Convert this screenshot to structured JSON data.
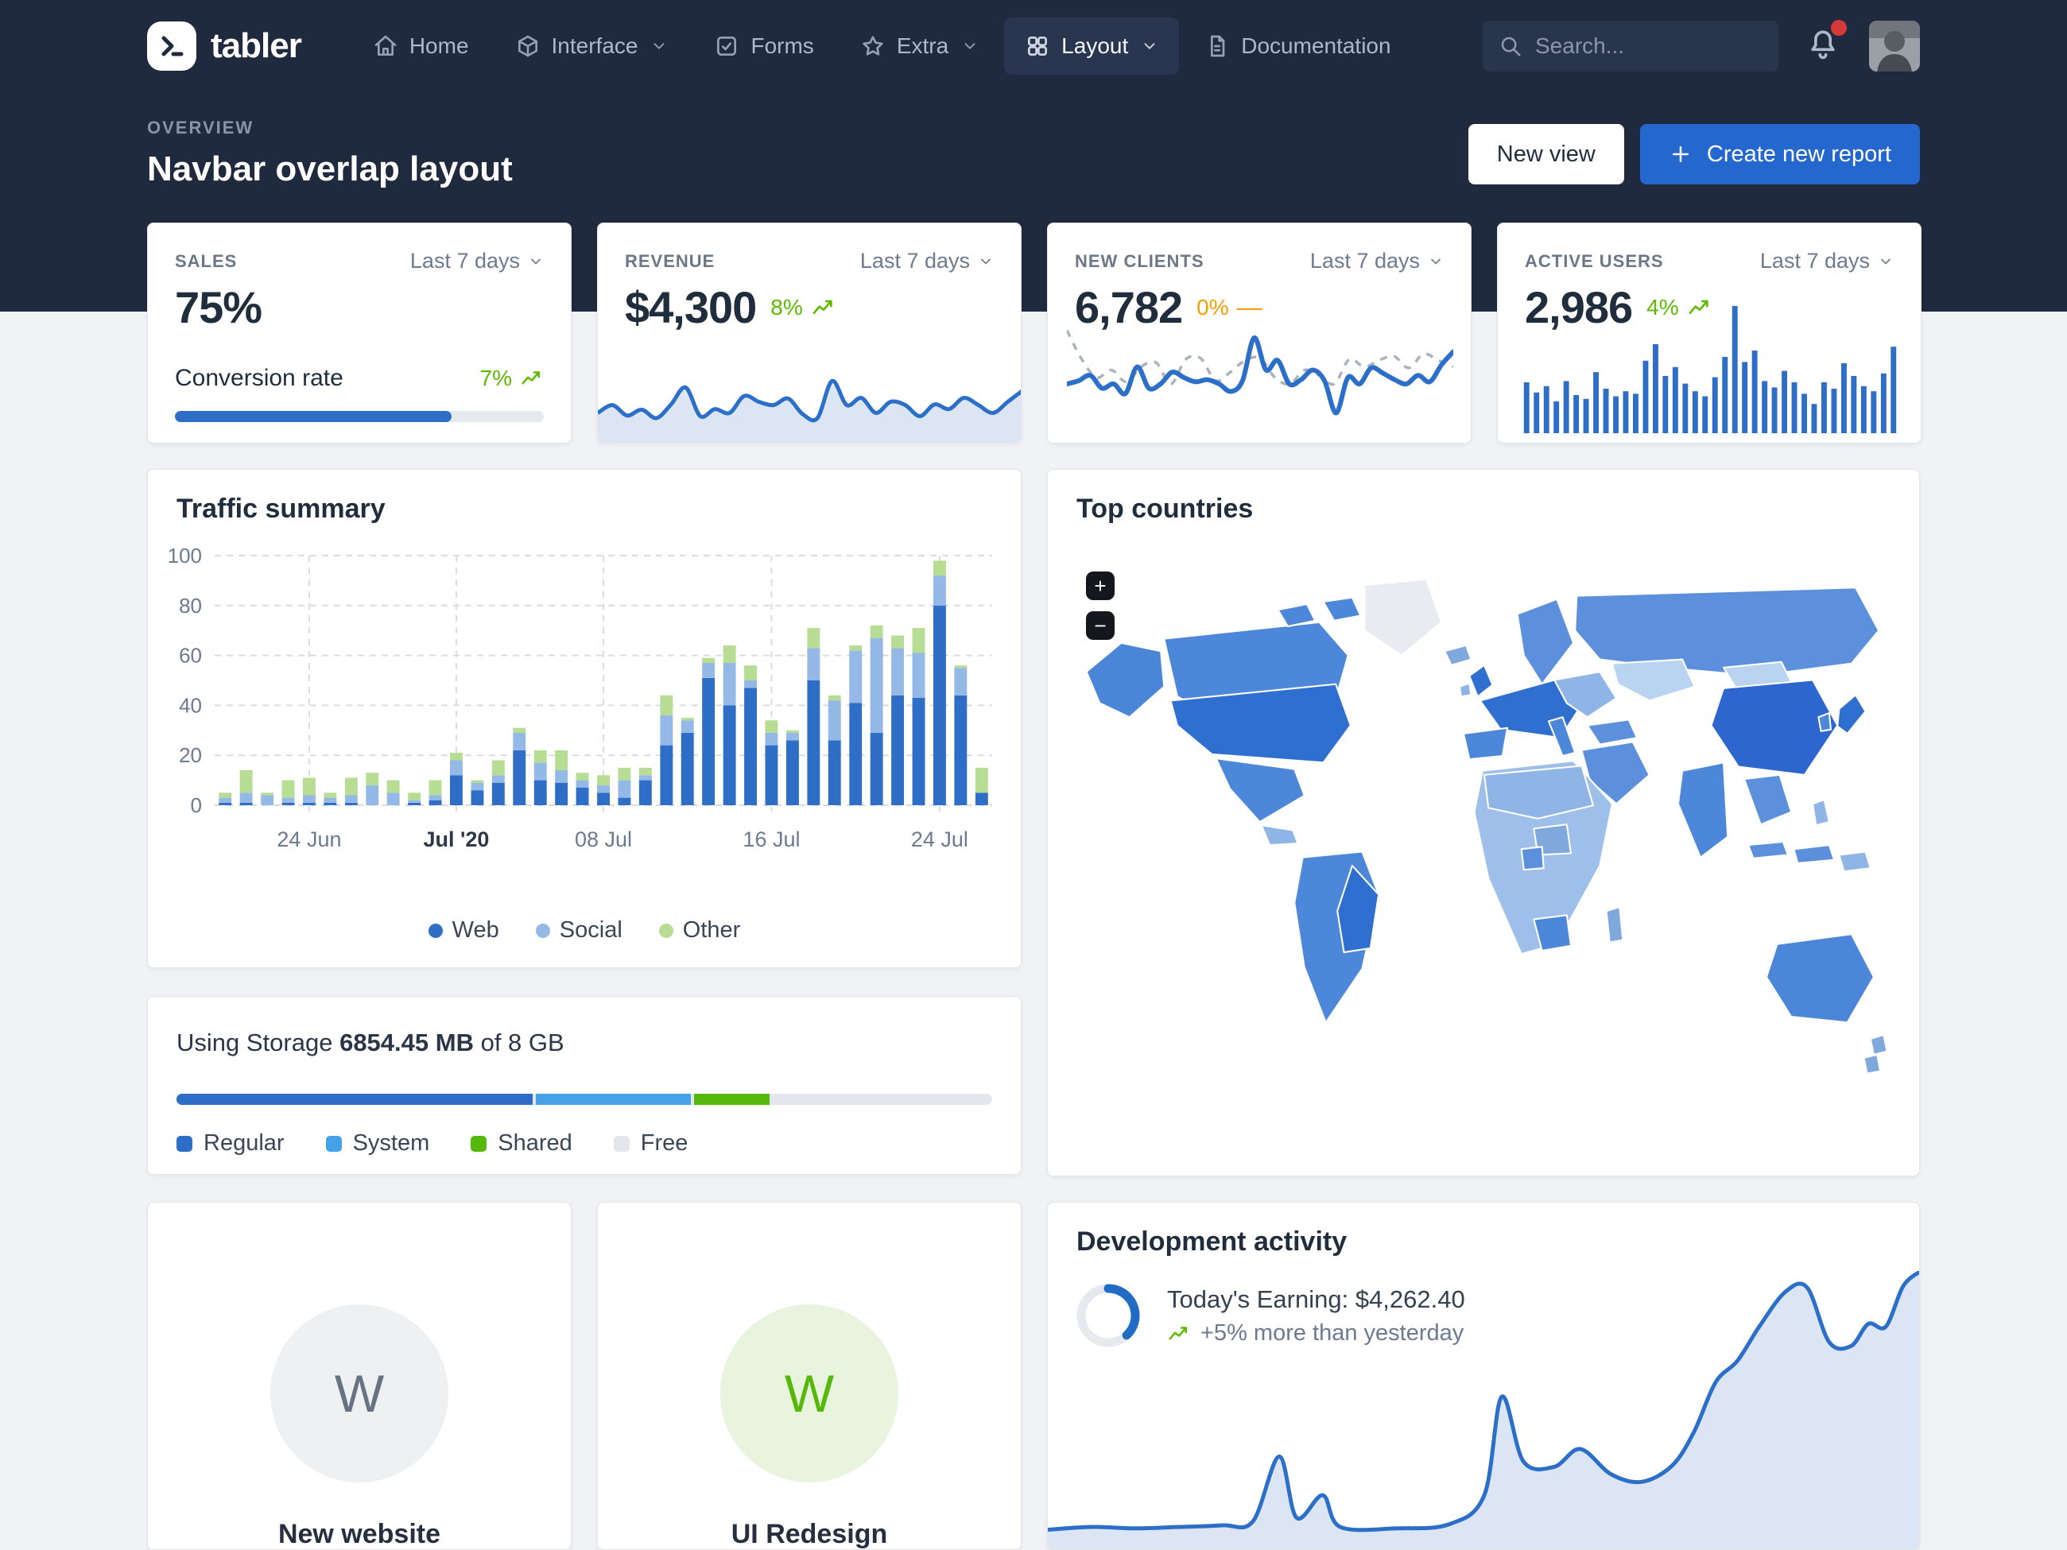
{
  "navbar": {
    "brand": "tabler",
    "search_placeholder": "Search...",
    "items": [
      {
        "label": "Home",
        "icon": "home-icon"
      },
      {
        "label": "Interface",
        "icon": "box-icon",
        "has_chevron": true
      },
      {
        "label": "Forms",
        "icon": "checkbox-icon"
      },
      {
        "label": "Extra",
        "icon": "star-icon",
        "has_chevron": true
      },
      {
        "label": "Layout",
        "icon": "layout-grid-icon",
        "has_chevron": true,
        "active": true
      },
      {
        "label": "Documentation",
        "icon": "document-icon"
      }
    ]
  },
  "header": {
    "eyebrow": "OVERVIEW",
    "title": "Navbar overlap layout",
    "new_view": "New view",
    "create_report": "Create new report"
  },
  "stats": [
    {
      "label": "SALES",
      "period": "Last 7 days",
      "value": "75%",
      "sub_label": "Conversion rate",
      "sub_delta": "7%",
      "progress_pct": 75
    },
    {
      "label": "REVENUE",
      "period": "Last 7 days",
      "value": "$4,300",
      "delta": "8%",
      "trend": "up"
    },
    {
      "label": "NEW CLIENTS",
      "period": "Last 7 days",
      "value": "6,782",
      "delta": "0%",
      "trend": "flat",
      "trend_glyph": "—"
    },
    {
      "label": "ACTIVE USERS",
      "period": "Last 7 days",
      "value": "2,986",
      "delta": "4%",
      "trend": "up"
    }
  ],
  "traffic": {
    "title": "Traffic summary"
  },
  "countries": {
    "title": "Top countries",
    "zoom_in": "+",
    "zoom_out": "−"
  },
  "storage": {
    "prefix": "Using Storage",
    "used": "6854.45 MB",
    "suffix": "of 8 GB",
    "legend": [
      "Regular",
      "System",
      "Shared",
      "Free"
    ],
    "segments": [
      {
        "name": "Regular",
        "pct": 43.7,
        "color": "#2f6ec7"
      },
      {
        "name": "System",
        "pct": 19.0,
        "color": "#45a2e8"
      },
      {
        "name": "Shared",
        "pct": 9.2,
        "color": "#56b80a"
      },
      {
        "name": "Free",
        "pct": 28.1,
        "color": "#e3e6ea"
      }
    ]
  },
  "projects": [
    {
      "initial": "W",
      "name": "New website",
      "tone": "gray"
    },
    {
      "initial": "W",
      "name": "UI Redesign",
      "tone": "green"
    }
  ],
  "development": {
    "title": "Development activity",
    "earning": "Today's Earning: $4,262.40",
    "note": "+5% more than yesterday",
    "donut_pct": 38
  },
  "colors": {
    "primary": "#206bc4",
    "green": "#5eba00",
    "amber": "#f59f00",
    "red": "#d63939",
    "web": "#2f6ec7",
    "social": "#95b9e6",
    "other": "#b7dd94",
    "spark_line": "#2c6fc9",
    "spark_fill": "#dbe5f3",
    "dash_gray": "#aab2bd",
    "grid": "#d9dde2",
    "donut_track": "#e6e9ed"
  },
  "chart_data": [
    {
      "id": "traffic-summary",
      "type": "bar",
      "stacked": true,
      "title": "Traffic summary",
      "ylim": [
        0,
        100
      ],
      "yticks": [
        0,
        20,
        40,
        60,
        80,
        100
      ],
      "grid": true,
      "legend_position": "bottom",
      "xticks": [
        {
          "index": 4,
          "label": "24 Jun"
        },
        {
          "index": 11,
          "label": "Jul '20",
          "bold": true
        },
        {
          "index": 18,
          "label": "08 Jul"
        },
        {
          "index": 26,
          "label": "16 Jul"
        },
        {
          "index": 34,
          "label": "24 Jul"
        }
      ],
      "series": [
        {
          "name": "Web",
          "values": [
            1,
            1,
            0,
            1,
            1,
            1,
            1,
            0,
            0,
            1,
            2,
            12,
            6,
            9,
            22,
            10,
            9,
            7,
            5,
            3,
            10,
            24,
            29,
            51,
            40,
            47,
            24,
            26,
            50,
            26,
            41,
            29,
            44,
            43,
            80,
            44,
            5
          ]
        },
        {
          "name": "Social",
          "values": [
            2,
            4,
            4,
            2,
            3,
            2,
            3,
            8,
            5,
            1,
            2,
            6,
            3,
            3,
            7,
            7,
            5,
            3,
            3,
            7,
            2,
            12,
            5,
            6,
            17,
            3,
            5,
            3,
            13,
            16,
            21,
            38,
            19,
            18,
            12,
            11,
            0
          ]
        },
        {
          "name": "Other",
          "values": [
            2,
            9,
            1,
            7,
            7,
            2,
            7,
            5,
            5,
            3,
            6,
            3,
            1,
            6,
            2,
            5,
            8,
            3,
            4,
            5,
            3,
            8,
            1,
            2,
            7,
            6,
            5,
            1,
            8,
            2,
            2,
            5,
            5,
            10,
            6,
            1,
            10
          ]
        }
      ]
    },
    {
      "id": "revenue-sparkline",
      "type": "area",
      "values": [
        0.36,
        0.48,
        0.32,
        0.41,
        0.28,
        0.49,
        0.75,
        0.31,
        0.42,
        0.36,
        0.62,
        0.53,
        0.48,
        0.58,
        0.34,
        0.28,
        0.85,
        0.48,
        0.59,
        0.36,
        0.53,
        0.48,
        0.31,
        0.49,
        0.42,
        0.59,
        0.48,
        0.36,
        0.53,
        0.7
      ]
    },
    {
      "id": "new-clients-sparkline",
      "type": "line",
      "series": [
        {
          "name": "current",
          "style": "solid",
          "values": [
            0.37,
            0.4,
            0.45,
            0.33,
            0.37,
            0.28,
            0.53,
            0.33,
            0.37,
            0.48,
            0.43,
            0.39,
            0.41,
            0.37,
            0.3,
            0.4,
            0.8,
            0.5,
            0.59,
            0.37,
            0.41,
            0.5,
            0.4,
            0.1,
            0.43,
            0.37,
            0.52,
            0.47,
            0.41,
            0.37,
            0.45,
            0.39,
            0.55,
            0.67
          ]
        },
        {
          "name": "previous",
          "style": "dashed",
          "values": [
            0.87,
            0.6,
            0.43,
            0.5,
            0.39,
            0.53,
            0.57,
            0.37,
            0.6,
            0.61,
            0.4,
            0.48,
            0.59,
            0.61,
            0.43,
            0.37,
            0.5,
            0.45,
            0.37,
            0.6,
            0.53,
            0.59,
            0.63,
            0.52,
            0.65,
            0.59,
            0.53
          ]
        }
      ]
    },
    {
      "id": "active-users-bars",
      "type": "bar",
      "values": [
        0.4,
        0.32,
        0.37,
        0.25,
        0.41,
        0.3,
        0.27,
        0.48,
        0.35,
        0.29,
        0.33,
        0.31,
        0.57,
        0.7,
        0.45,
        0.52,
        0.39,
        0.33,
        0.29,
        0.44,
        0.6,
        1.0,
        0.56,
        0.65,
        0.41,
        0.36,
        0.49,
        0.4,
        0.31,
        0.23,
        0.4,
        0.35,
        0.55,
        0.45,
        0.37,
        0.33,
        0.47,
        0.68
      ]
    },
    {
      "id": "development-activity",
      "type": "area",
      "points": [
        [
          0,
          0.07
        ],
        [
          0.05,
          0.08
        ],
        [
          0.1,
          0.075
        ],
        [
          0.15,
          0.08
        ],
        [
          0.2,
          0.086
        ],
        [
          0.235,
          0.1
        ],
        [
          0.265,
          0.333
        ],
        [
          0.285,
          0.113
        ],
        [
          0.315,
          0.194
        ],
        [
          0.335,
          0.08
        ],
        [
          0.4,
          0.075
        ],
        [
          0.46,
          0.09
        ],
        [
          0.5,
          0.194
        ],
        [
          0.52,
          0.548
        ],
        [
          0.545,
          0.315
        ],
        [
          0.58,
          0.296
        ],
        [
          0.61,
          0.36
        ],
        [
          0.645,
          0.27
        ],
        [
          0.68,
          0.242
        ],
        [
          0.715,
          0.3
        ],
        [
          0.74,
          0.42
        ],
        [
          0.765,
          0.6
        ],
        [
          0.79,
          0.677
        ],
        [
          0.815,
          0.8
        ],
        [
          0.845,
          0.925
        ],
        [
          0.87,
          0.94
        ],
        [
          0.895,
          0.745
        ],
        [
          0.92,
          0.73
        ],
        [
          0.94,
          0.81
        ],
        [
          0.96,
          0.8
        ],
        [
          0.98,
          0.946
        ],
        [
          1,
          1.0
        ]
      ]
    },
    {
      "id": "earnings-donut",
      "type": "donut",
      "pct": 38
    }
  ]
}
